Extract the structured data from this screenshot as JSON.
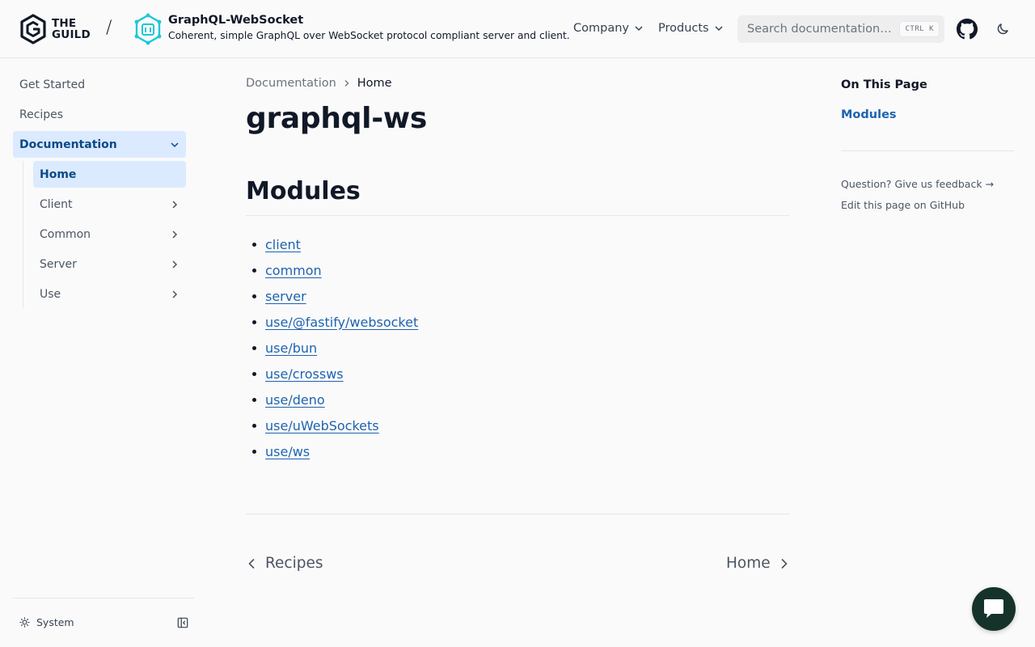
{
  "navbar": {
    "guild_word_line1": "THE",
    "guild_word_line2": "GUILD",
    "separator": "/",
    "project_title": "GraphQL-WebSocket",
    "project_description": "Coherent, simple GraphQL over WebSocket protocol compliant server and client.",
    "menus": [
      {
        "label": "Company"
      },
      {
        "label": "Products"
      }
    ],
    "search": {
      "placeholder": "Search documentation…",
      "shortcut": "CTRL K"
    }
  },
  "sidebar": {
    "items": [
      {
        "label": "Get Started"
      },
      {
        "label": "Recipes"
      },
      {
        "label": "Documentation",
        "expanded": true
      }
    ],
    "sub_items": [
      {
        "label": "Home",
        "active": true
      },
      {
        "label": "Client"
      },
      {
        "label": "Common"
      },
      {
        "label": "Server"
      },
      {
        "label": "Use"
      }
    ],
    "theme_label": "System"
  },
  "breadcrumb": {
    "parent": "Documentation",
    "current": "Home"
  },
  "page": {
    "title": "graphql-ws",
    "section_heading": "Modules",
    "modules": [
      "client",
      "common",
      "server",
      "use/@fastify/websocket",
      "use/bun",
      "use/crossws",
      "use/deno",
      "use/uWebSockets",
      "use/ws"
    ]
  },
  "pager": {
    "prev": "Recipes",
    "next": "Home"
  },
  "toc": {
    "title": "On This Page",
    "links": [
      "Modules"
    ],
    "feedback": "Question? Give us feedback →",
    "edit": "Edit this page on GitHub"
  },
  "colors": {
    "accent": "#1e63b0",
    "active_bg": "#dbeafe",
    "active_text": "#0b4a87",
    "project_logo": "#1cc8d8",
    "chat_bg": "#15332b"
  }
}
